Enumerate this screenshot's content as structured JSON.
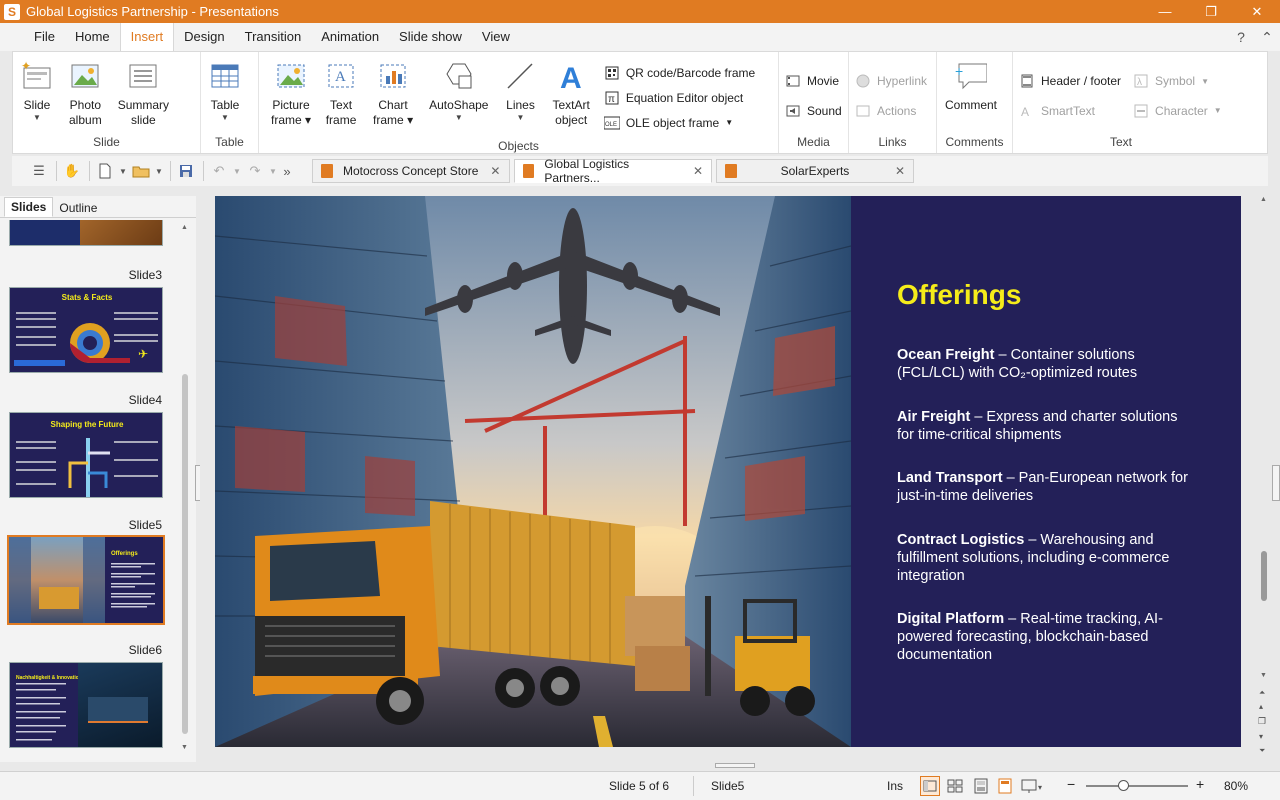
{
  "window": {
    "title": "Global Logistics Partnership - Presentations",
    "app_icon": "S"
  },
  "menu": {
    "items": [
      "File",
      "Home",
      "Insert",
      "Design",
      "Transition",
      "Animation",
      "Slide show",
      "View"
    ],
    "active": "Insert"
  },
  "ribbon": {
    "slide_group": {
      "label": "Slide",
      "slide": "Slide",
      "photo_album_1": "Photo",
      "photo_album_2": "album",
      "summary_1": "Summary",
      "summary_2": "slide"
    },
    "table_group": {
      "label": "Table",
      "table": "Table"
    },
    "objects_group": {
      "label": "Objects",
      "picture_1": "Picture",
      "picture_2": "frame",
      "text_1": "Text",
      "text_2": "frame",
      "chart_1": "Chart",
      "chart_2": "frame",
      "autoshape": "AutoShape",
      "lines": "Lines",
      "textart_1": "TextArt",
      "textart_2": "object",
      "qr": "QR code/Barcode frame",
      "equation": "Equation Editor object",
      "ole": "OLE object frame"
    },
    "media_group": {
      "label": "Media",
      "movie": "Movie",
      "sound": "Sound"
    },
    "links_group": {
      "label": "Links",
      "hyperlink": "Hyperlink",
      "actions": "Actions"
    },
    "comments_group": {
      "label": "Comments",
      "comment": "Comment"
    },
    "text_group": {
      "label": "Text",
      "header_footer": "Header / footer",
      "symbol": "Symbol",
      "smarttext": "SmartText",
      "character": "Character"
    }
  },
  "doc_tabs": [
    {
      "label": "Motocross Concept Store"
    },
    {
      "label": "Global Logistics Partners..."
    },
    {
      "label": "SolarExperts"
    }
  ],
  "panel": {
    "tab_slides": "Slides",
    "tab_outline": "Outline",
    "thumbs": [
      {
        "label": "Slide3",
        "title": "Stats & Facts"
      },
      {
        "label": "Slide4",
        "title": "Shaping the Future"
      },
      {
        "label": "Slide5",
        "title": "Offerings"
      },
      {
        "label": "Slide6",
        "title": "Nachhaltigkeit & Innovation"
      }
    ]
  },
  "slide": {
    "title": "Offerings",
    "offerings": [
      {
        "name": "Ocean Freight",
        "desc": " – Container solutions (FCL/LCL) with CO₂-optimized routes"
      },
      {
        "name": "Air Freight",
        "desc": " – Express and charter solutions for time-critical shipments"
      },
      {
        "name": "Land Transport",
        "desc": " – Pan-European network for just-in-time deliveries"
      },
      {
        "name": "Contract Logistics",
        "desc": " – Warehousing and fulfillment solutions, including e-commerce integration"
      },
      {
        "name": "Digital Platform",
        "desc": " – Real-time tracking, AI-powered forecasting, blockchain-based documentation"
      }
    ],
    "colors": {
      "background": "#232058",
      "title": "#f5ec1a",
      "text": "#ffffff"
    }
  },
  "status": {
    "slide_pos": "Slide 5 of 6",
    "slide_name": "Slide5",
    "mode": "Ins",
    "zoom": "80%",
    "zoom_minus": "−",
    "zoom_plus": "+"
  },
  "colors": {
    "accent": "#e07b22"
  }
}
